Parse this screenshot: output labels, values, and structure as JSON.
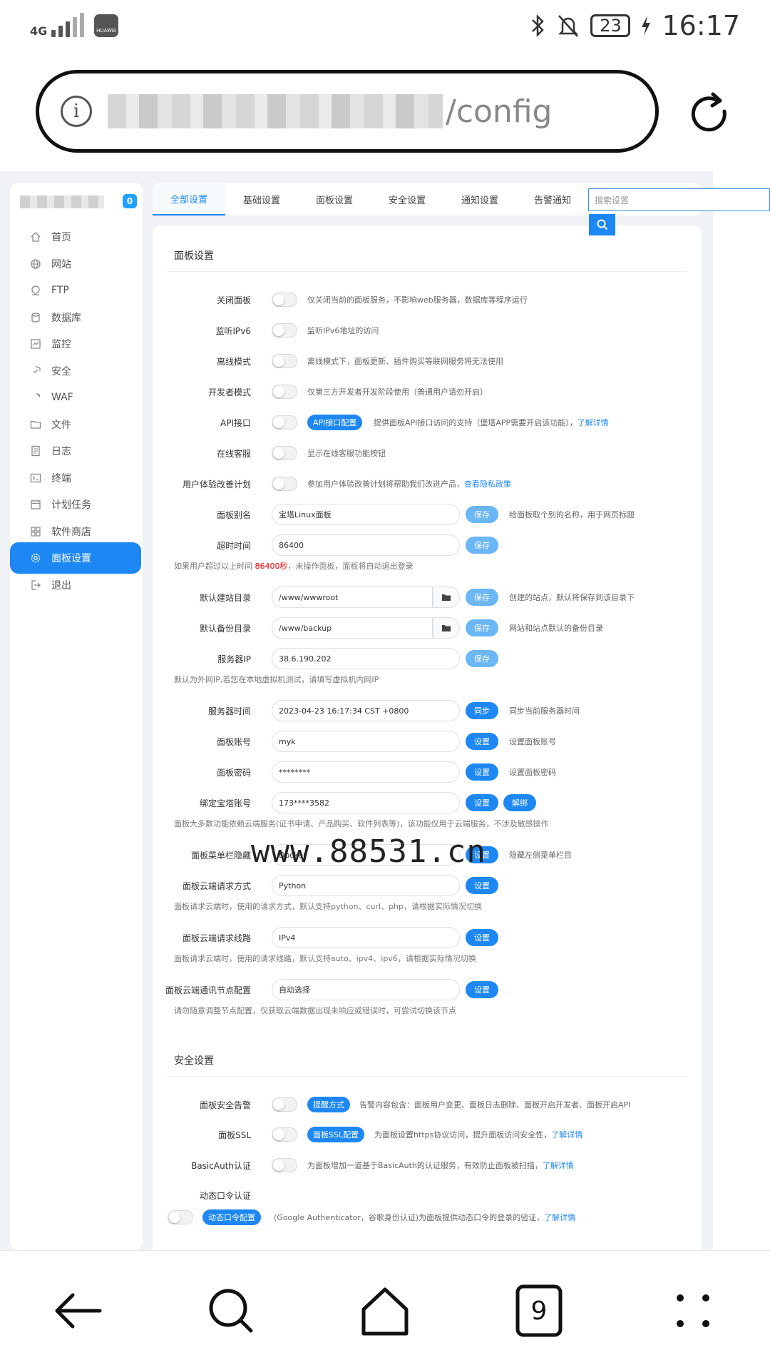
{
  "status": {
    "network": "4G",
    "brand": "HUAWEI",
    "battery": "23",
    "time": "16:17"
  },
  "browser": {
    "url_suffix": "/config",
    "tab_count": "9"
  },
  "sidebar": {
    "badge": "0",
    "items": [
      {
        "label": "首页",
        "icon": "home-icon"
      },
      {
        "label": "网站",
        "icon": "globe-icon"
      },
      {
        "label": "FTP",
        "icon": "ftp-icon"
      },
      {
        "label": "数据库",
        "icon": "database-icon"
      },
      {
        "label": "监控",
        "icon": "monitor-icon"
      },
      {
        "label": "安全",
        "icon": "shield-icon"
      },
      {
        "label": "WAF",
        "icon": "waf-shield-icon"
      },
      {
        "label": "文件",
        "icon": "folder-icon"
      },
      {
        "label": "日志",
        "icon": "log-icon"
      },
      {
        "label": "终端",
        "icon": "terminal-icon"
      },
      {
        "label": "计划任务",
        "icon": "calendar-icon"
      },
      {
        "label": "软件商店",
        "icon": "grid-icon"
      },
      {
        "label": "面板设置",
        "icon": "gear-icon"
      },
      {
        "label": "退出",
        "icon": "logout-icon"
      }
    ],
    "active_index": 12
  },
  "tabs": [
    "全部设置",
    "基础设置",
    "面板设置",
    "安全设置",
    "通知设置",
    "告警通知"
  ],
  "search": {
    "placeholder": "搜索设置"
  },
  "panel_section": {
    "title": "面板设置",
    "close_panel": {
      "label": "关闭面板",
      "hint": "仅关闭当前的面板服务，不影响web服务器，数据库等程序运行"
    },
    "ipv6": {
      "label": "监听IPv6",
      "hint": "监听IPv6地址的访问"
    },
    "offline": {
      "label": "离线模式",
      "hint": "离线模式下，面板更新、插件购买等联网服务将无法使用"
    },
    "dev": {
      "label": "开发者模式",
      "hint": "仅第三方开发者开发阶段使用（普通用户请勿开启）"
    },
    "api": {
      "label": "API接口",
      "pill": "API接口配置",
      "hint": "提供面板API接口访问的支持（堡塔APP需要开启该功能），",
      "link": "了解详情"
    },
    "support": {
      "label": "在线客服",
      "hint": "显示在线客服功能按钮"
    },
    "ux": {
      "label": "用户体验改善计划",
      "hint": "参加用户体验改善计划将帮助我们改进产品，",
      "link": "查看隐私政策"
    },
    "alias": {
      "label": "面板别名",
      "value": "宝塔Linux面板",
      "button": "保存",
      "hint": "给面板取个别的名称，用于网页标题"
    },
    "timeout": {
      "label": "超时时间",
      "value": "86400",
      "button": "保存",
      "note_pre": "如果用户超过以上时间 ",
      "note_red": "86400秒",
      "note_post": "，未操作面板，面板将自动退出登录"
    },
    "site_dir": {
      "label": "默认建站目录",
      "value": "/www/wwwroot",
      "button": "保存",
      "hint": "创建的站点，默认将保存到该目录下"
    },
    "backup_dir": {
      "label": "默认备份目录",
      "value": "/www/backup",
      "button": "保存",
      "hint": "网站和站点默认的备份目录"
    },
    "server_ip": {
      "label": "服务器IP",
      "value": "38.6.190.202",
      "button": "保存",
      "note": "默认为外网IP,若您在本地虚拟机测试，请填写虚拟机内网IP"
    },
    "server_time": {
      "label": "服务器时间",
      "value": "2023-04-23 16:17:34 CST +0800",
      "button": "同步",
      "hint": "同步当前服务器时间"
    },
    "account": {
      "label": "面板账号",
      "value": "myk",
      "button": "设置",
      "hint": "设置面板账号"
    },
    "password": {
      "label": "面板密码",
      "value": "********",
      "button": "设置",
      "hint": "设置面板密码"
    },
    "bt_account": {
      "label": "绑定宝塔账号",
      "value": "173****3582",
      "button": "设置",
      "button2": "解绑",
      "note": "面板大多数功能依赖云端服务(证书申请、产品购买、软件列表等)，该功能仅用于云端服务，不涉及敏感操作"
    },
    "menu_hide": {
      "label": "面板菜单栏隐藏",
      "value": "Docker",
      "button": "设置",
      "hint": "隐藏左侧菜单栏目"
    },
    "req_method": {
      "label": "面板云端请求方式",
      "value": "Python",
      "button": "设置",
      "note": "面板请求云端时，使用的请求方式，默认支持python、curl、php，请根据实际情况切换"
    },
    "req_line": {
      "label": "面板云端请求线路",
      "value": "IPv4",
      "button": "设置",
      "note": "面板请求云端时，使用的请求线路，默认支持auto、ipv4、ipv6，请根据实际情况切换"
    },
    "node": {
      "label": "面板云端通讯节点配置",
      "value": "自动选择",
      "button": "设置",
      "note": "请勿随意调整节点配置，仅获取云端数据出现未响应或错误时，可尝试切换该节点"
    }
  },
  "security_section": {
    "title": "安全设置",
    "alarm": {
      "label": "面板安全告警",
      "pill": "提醒方式",
      "hint": "告警内容包含：面板用户变更、面板日志删除、面板开启开发者、面板开启API"
    },
    "ssl": {
      "label": "面板SSL",
      "pill": "面板SSL配置",
      "hint": "为面板设置https协议访问，提升面板访问安全性，",
      "link": "了解详情"
    },
    "basic_auth": {
      "label": "BasicAuth认证",
      "hint": "为面板增加一道基于BasicAuth的认证服务，有效防止面板被扫描，",
      "link": "了解详情"
    },
    "otp": {
      "label": "动态口令认证",
      "pill": "动态口令配置",
      "hint": "(Google Authenticator，谷歌身份认证)为面板提供动态口令的登录的验证，",
      "link": "了解详情"
    }
  },
  "watermark": "www.88531.cn",
  "colors": {
    "accent": "#1d87f3",
    "accent_light": "#6bb6f6",
    "warning_text": "#e00000"
  }
}
